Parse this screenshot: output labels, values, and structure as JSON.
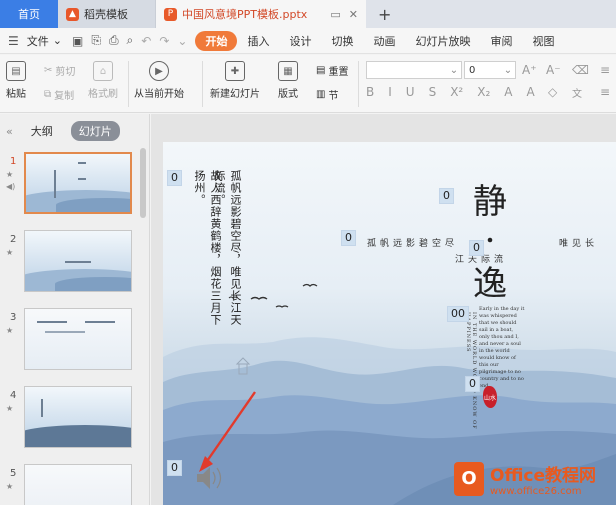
{
  "tabs": {
    "home": "首页",
    "doc": "稻壳模板",
    "active": "中国风意境PPT模板.pptx",
    "plus": "+"
  },
  "menu": {
    "file": "文件",
    "items": [
      "开始",
      "插入",
      "设计",
      "切换",
      "动画",
      "幻灯片放映",
      "审阅",
      "视图"
    ],
    "active_index": 0
  },
  "ribbon": {
    "paste": "粘贴",
    "cut": "剪切",
    "copy": "复制",
    "format_painter": "格式刷",
    "from_current": "从当前开始",
    "new_slide": "新建幻灯片",
    "layout": "版式",
    "reset": "重置",
    "section": "节",
    "font_size": "0",
    "font_name": "",
    "font_buttons": [
      "B",
      "I",
      "U",
      "S",
      "X²",
      "X₂",
      "A",
      "A"
    ]
  },
  "left_panel": {
    "tabs": [
      "大纲",
      "幻灯片"
    ],
    "active_tab": 1,
    "slide_numbers": [
      "1",
      "2",
      "3",
      "4",
      "5"
    ]
  },
  "slide": {
    "poem_col1": "故人西辞黄鹤楼，烟花三月下扬州。",
    "poem_col2": "孤帆远影碧空尽，唯见长江天际流。",
    "title_char1": "静",
    "title_char2": "逸",
    "line_a": "孤帆远影碧空尽",
    "line_a_end": "唯见长",
    "line_b": "江天际流",
    "en_para": "Early in the day it was whispered that we should sail in a boat, only thou and I, and never a soul in the world would know of this our pilgrimage to no country and to no end.",
    "en_vertical": "IN THE WORLD WOULD KNOW OF HAPPINESS",
    "seal_text": "山水",
    "placeholders": [
      "0",
      "0",
      "0",
      "00",
      "0",
      "0",
      "0"
    ]
  },
  "watermark": {
    "logo": "O",
    "brand": "Office教程网",
    "url": "www.office26.com"
  },
  "colors": {
    "accent": "#f07a3a",
    "home_tab": "#3b7ee5",
    "brand": "#e85a1f",
    "seal": "#c8202b"
  }
}
